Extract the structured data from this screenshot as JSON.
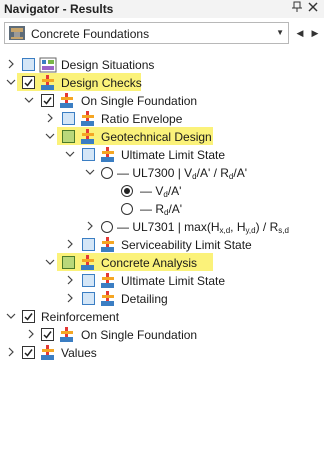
{
  "window": {
    "title": "Navigator - Results",
    "pin_icon": "pin-icon",
    "close_icon": "close-icon"
  },
  "selector": {
    "value": "Concrete Foundations",
    "icon": "concrete-foundation-icon"
  },
  "tree": {
    "design_situations": "Design Situations",
    "design_checks": "Design Checks",
    "on_single_foundation": "On Single Foundation",
    "ratio_envelope": "Ratio Envelope",
    "geotechnical_design": "Geotechnical Design",
    "ultimate_limit_state": "Ultimate Limit State",
    "ul7300": {
      "a": "UL7300 | V",
      "s1": "d",
      "b": "/A' / R",
      "s2": "d",
      "c": "/A'"
    },
    "vd_a": {
      "a": "V",
      "s1": "d",
      "b": "/A'"
    },
    "rd_a": {
      "a": "R",
      "s1": "d",
      "b": "/A'"
    },
    "ul7301": {
      "a": "UL7301 | max(H",
      "s1": "x,d",
      "b": ", H",
      "s2": "y,d",
      "c": ") / R",
      "s3": "s,d"
    },
    "serviceability_limit_state": "Serviceability Limit State",
    "concrete_analysis": "Concrete Analysis",
    "ultimate_limit_state_2": "Ultimate Limit State",
    "detailing": "Detailing",
    "reinforcement": "Reinforcement",
    "on_single_foundation_2": "On Single Foundation",
    "values": "Values"
  },
  "colors": {
    "highlight": "#fbf27a",
    "checkbox_blue": "#d4e6f7",
    "checkbox_green": "#b9d87a"
  }
}
